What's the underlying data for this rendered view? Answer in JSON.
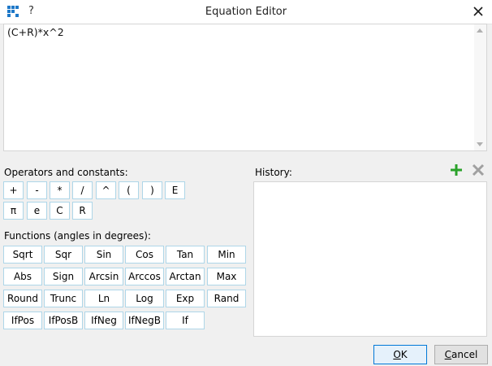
{
  "window": {
    "title": "Equation Editor",
    "help": "?"
  },
  "editor": {
    "value": "(C+R)*x^2"
  },
  "operators": {
    "label": "Operators and constants:",
    "row1": [
      "+",
      "-",
      "*",
      "/",
      "^",
      "(",
      ")",
      "E"
    ],
    "row2": [
      "π",
      "e",
      "C",
      "R"
    ]
  },
  "functions": {
    "label": "Functions (angles in degrees):",
    "rows": [
      [
        "Sqrt",
        "Sqr",
        "Sin",
        "Cos",
        "Tan",
        "Min"
      ],
      [
        "Abs",
        "Sign",
        "Arcsin",
        "Arccos",
        "Arctan",
        "Max"
      ],
      [
        "Round",
        "Trunc",
        "Ln",
        "Log",
        "Exp",
        "Rand"
      ],
      [
        "IfPos",
        "IfPosB",
        "IfNeg",
        "IfNegB",
        "If"
      ]
    ]
  },
  "history": {
    "label": "History:",
    "items": []
  },
  "dialog": {
    "ok_mnemonic": "O",
    "ok_rest": "K",
    "cancel_mnemonic": "C",
    "cancel_rest": "ancel"
  },
  "icons": {
    "app": "grid-icon",
    "add": "plus-icon",
    "remove": "x-icon",
    "close": "close-icon"
  },
  "colors": {
    "add_green": "#2aa22a",
    "remove_gray": "#a0a0a0",
    "app_blue": "#1e78c8",
    "button_border": "#aed6e8"
  }
}
